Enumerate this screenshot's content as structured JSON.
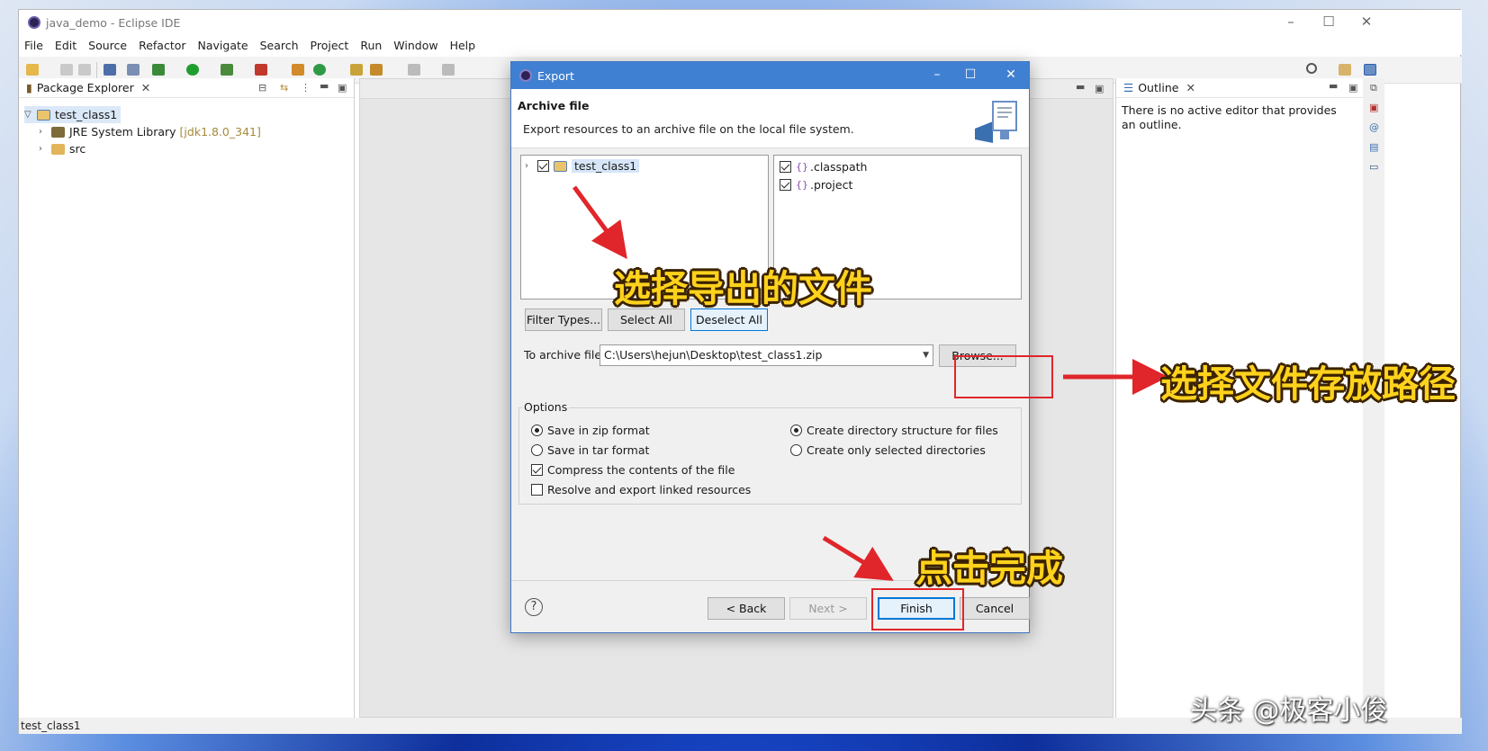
{
  "window": {
    "title": "java_demo - Eclipse IDE"
  },
  "menu": [
    "File",
    "Edit",
    "Source",
    "Refactor",
    "Navigate",
    "Search",
    "Project",
    "Run",
    "Window",
    "Help"
  ],
  "package_explorer": {
    "tab_label": "Package Explorer",
    "items": [
      {
        "label": "test_class1"
      },
      {
        "label": "JRE System Library",
        "extra": "[jdk1.8.0_341]"
      },
      {
        "label": "src"
      }
    ]
  },
  "outline": {
    "tab_label": "Outline",
    "message": "There is no active editor that provides an outline."
  },
  "status_bar": {
    "text": "test_class1"
  },
  "dialog": {
    "title": "Export",
    "header_title": "Archive file",
    "header_desc": "Export resources to an archive file on the local file system.",
    "left_tree": [
      {
        "label": "test_class1",
        "checked": true
      }
    ],
    "right_list": [
      {
        "label": ".classpath",
        "checked": true
      },
      {
        "label": ".project",
        "checked": true
      }
    ],
    "buttons": {
      "filter_types": "Filter Types...",
      "select_all": "Select All",
      "deselect_all": "Deselect All",
      "browse": "Browse...",
      "back": "< Back",
      "next": "Next >",
      "finish": "Finish",
      "cancel": "Cancel"
    },
    "archive_label": "To archive file:",
    "archive_value": "C:\\Users\\hejun\\Desktop\\test_class1.zip",
    "options": {
      "legend": "Options",
      "save_zip": "Save in zip format",
      "save_tar": "Save in tar format",
      "compress": "Compress the contents of the file",
      "resolve_links": "Resolve and export linked resources",
      "create_dir": "Create directory structure for files",
      "create_selected": "Create only selected directories"
    },
    "help_glyph": "?"
  },
  "annotations": {
    "select_files": "选择导出的文件",
    "choose_path": "选择文件存放路径",
    "click_finish": "点击完成"
  },
  "watermark": "头条 @极客小俊",
  "colors": {
    "dialog_title_bar": "#3f80d2",
    "annotation_text": "#ffd21c",
    "annotation_arrow": "#e0262a"
  }
}
